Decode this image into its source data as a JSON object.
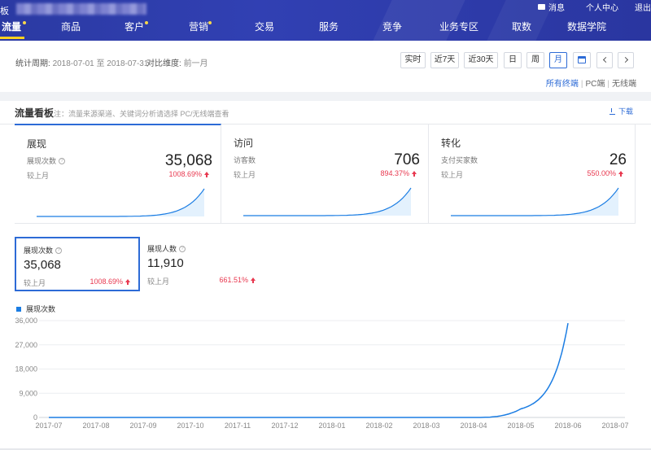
{
  "header": {
    "brand_fragment": "板",
    "top_links": {
      "messages": "消息",
      "personal_center": "个人中心",
      "logout": "退出"
    },
    "nav": [
      {
        "label": "流量",
        "active": true,
        "dot": true
      },
      {
        "label": "商品",
        "active": false,
        "dot": false
      },
      {
        "label": "客户",
        "active": false,
        "dot": true
      },
      {
        "label": "营销",
        "active": false,
        "dot": true
      },
      {
        "label": "交易",
        "active": false,
        "dot": false
      },
      {
        "label": "服务",
        "active": false,
        "dot": false
      },
      {
        "label": "竞争",
        "active": false,
        "dot": false
      },
      {
        "label": "业务专区",
        "active": false,
        "dot": false
      },
      {
        "label": "取数",
        "active": false,
        "dot": false
      },
      {
        "label": "数据学院",
        "active": false,
        "dot": false
      }
    ]
  },
  "filter": {
    "period_label": "统计周期:",
    "period_value": "2018-07-01 至 2018-07-31",
    "dim_label": "对比维度:",
    "dim_value": "前一月",
    "buttons": [
      "实时",
      "近7天",
      "近30天",
      "日",
      "周",
      "月"
    ],
    "selected": "月",
    "terminal": {
      "all": "所有终端",
      "pc": "PC端",
      "wireless": "无线端"
    }
  },
  "panel": {
    "title": "流量看板",
    "note": "注：流量来源渠道、关键词分析请选择 PC/无线端查看",
    "download": "下载",
    "cards": [
      {
        "title": "展现",
        "metric": "展现次数",
        "value": "35,068",
        "compare": "较上月",
        "pct": "1008.69%",
        "help": true
      },
      {
        "title": "访问",
        "metric": "访客数",
        "value": "706",
        "compare": "较上月",
        "pct": "894.37%",
        "help": false
      },
      {
        "title": "转化",
        "metric": "支付买家数",
        "value": "26",
        "compare": "较上月",
        "pct": "550.00%",
        "help": false
      }
    ],
    "sub_metrics": [
      {
        "label": "展现次数",
        "value": "35,068",
        "compare": "较上月",
        "pct": "1008.69%"
      },
      {
        "label": "展现人数",
        "value": "11,910",
        "compare": "较上月",
        "pct": "661.51%"
      }
    ]
  },
  "colors": {
    "accent": "#2d6bd6",
    "series": "#1b7de3",
    "up": "#e8384f",
    "nav_bg": "#2f3cac"
  },
  "chart_data": {
    "type": "line",
    "series": [
      {
        "name": "展现次数",
        "values": [
          0,
          0,
          0,
          0,
          0,
          0,
          0,
          0,
          0,
          0,
          3168,
          35068
        ]
      }
    ],
    "categories": [
      "2017-07",
      "2017-08",
      "2017-09",
      "2017-10",
      "2017-11",
      "2017-12",
      "2018-01",
      "2018-02",
      "2018-03",
      "2018-04",
      "2018-05",
      "2018-06",
      "2018-07"
    ],
    "x_tick_labels": [
      "2017-07",
      "2017-08",
      "2017-09",
      "2017-10",
      "2017-11",
      "2017-12",
      "2018-01",
      "2018-02",
      "2018-03",
      "2018-04",
      "2018-05",
      "2018-06",
      "2018-07"
    ],
    "y_tick_labels": [
      "0",
      "9,000",
      "18,000",
      "27,000",
      "36,000"
    ],
    "ylim": [
      0,
      36000
    ],
    "grid": true,
    "legend": "top-left"
  }
}
